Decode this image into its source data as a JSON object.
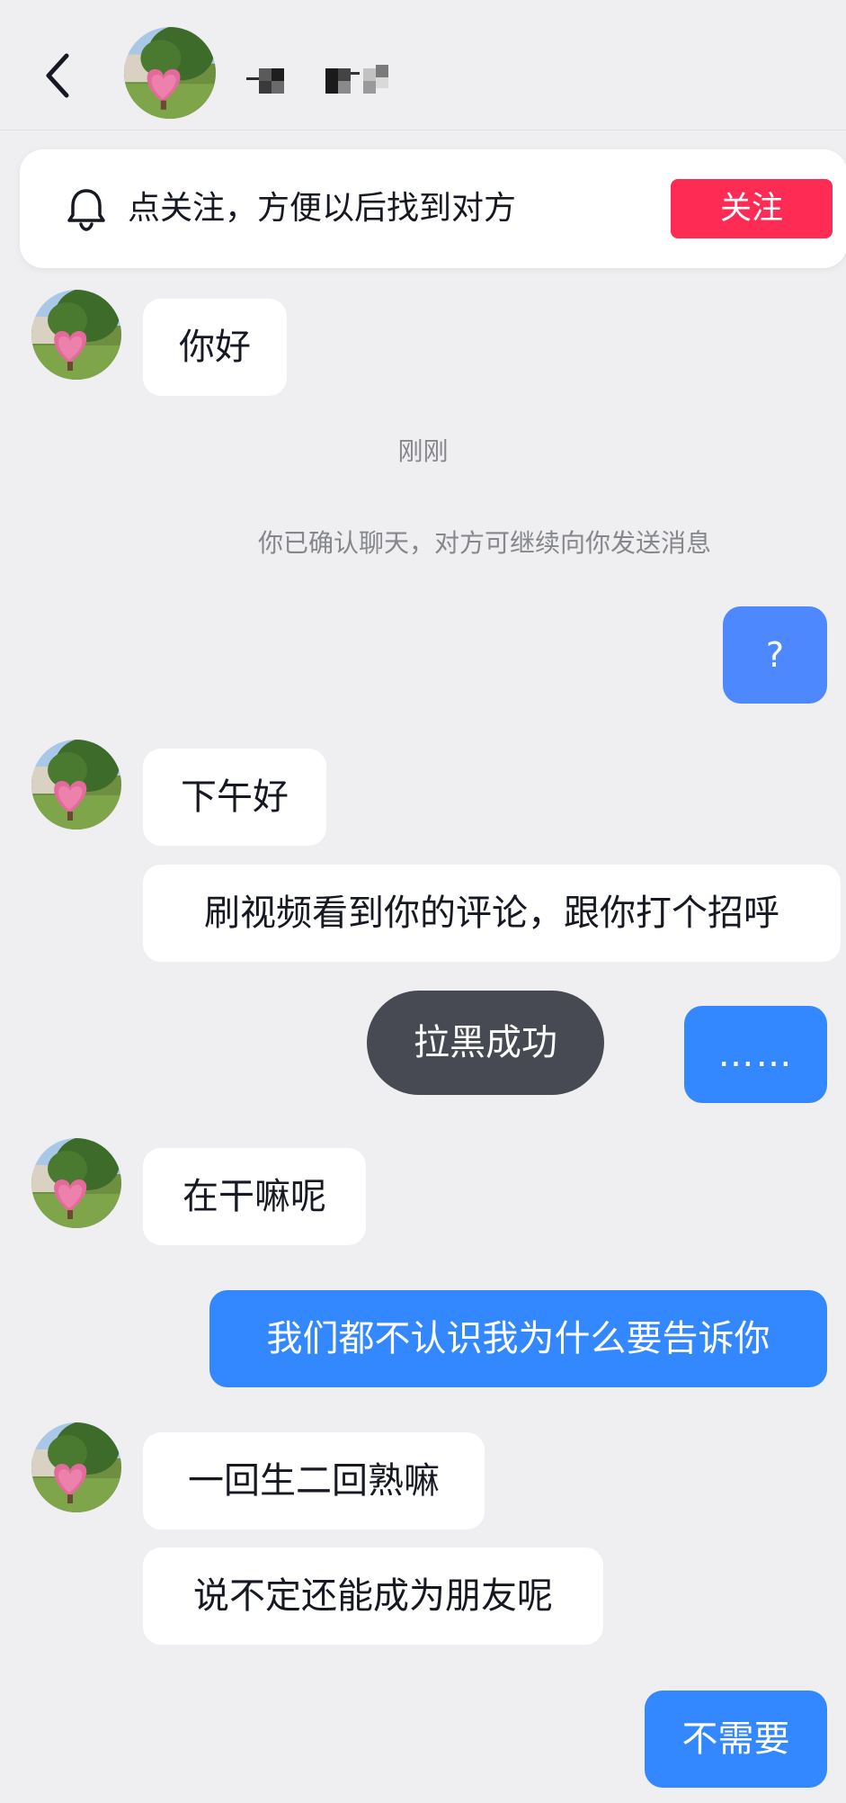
{
  "header": {
    "contact_name": "-▖ ▛▘",
    "back_icon": "chevron-left-icon"
  },
  "follow_banner": {
    "icon": "bell-icon",
    "text": "点关注，方便以后找到对方",
    "button_label": "关注"
  },
  "messages": [
    {
      "side": "in",
      "text": "你好"
    },
    {
      "side": "out",
      "text": "?"
    },
    {
      "side": "in",
      "text": "下午好"
    },
    {
      "side": "in",
      "text": "刷视频看到你的评论，跟你打个招呼"
    },
    {
      "side": "out",
      "text": "……"
    },
    {
      "side": "in",
      "text": "在干嘛呢"
    },
    {
      "side": "out",
      "text": "我们都不认识我为什么要告诉你"
    },
    {
      "side": "in",
      "text": "一回生二回熟嘛"
    },
    {
      "side": "in",
      "text": "说不定还能成为朋友呢"
    },
    {
      "side": "out",
      "text": "不需要"
    }
  ],
  "time_label": "刚刚",
  "system_notice": "你已确认聊天，对方可继续向你发送消息",
  "toast": "拉黑成功",
  "colors": {
    "background": "#efeff1",
    "outgoing_bubble": "#3388ff",
    "follow_button": "#fe2c55",
    "toast": "#474a52"
  }
}
